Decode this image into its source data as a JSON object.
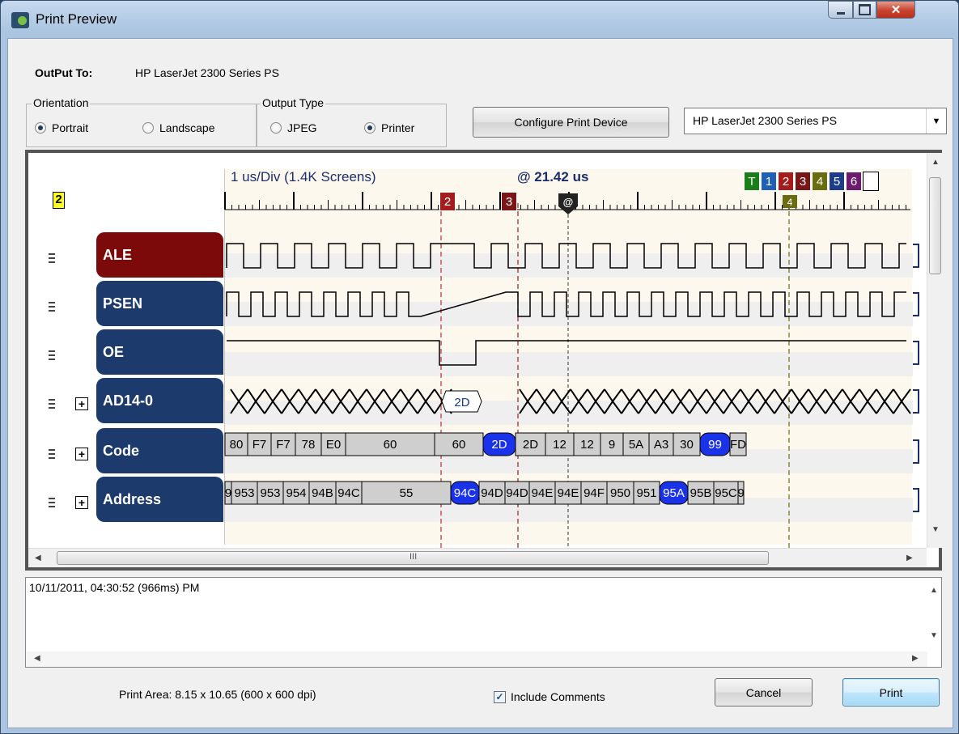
{
  "window": {
    "title": "Print Preview"
  },
  "output": {
    "label": "OutPut To:",
    "value": "HP LaserJet 2300 Series PS"
  },
  "orientation": {
    "title": "Orientation",
    "portrait": "Portrait",
    "landscape": "Landscape",
    "selected": "Portrait"
  },
  "output_type": {
    "title": "Output Type",
    "jpeg": "JPEG",
    "printer": "Printer",
    "selected": "Printer"
  },
  "configure_button": "Configure Print Device",
  "printer_select": {
    "value": "HP LaserJet 2300 Series PS"
  },
  "preview": {
    "group_marker": "2",
    "ruler_info": "1 us/Div  (1.4K Screens)",
    "ruler_at": "@ 21.42 us",
    "ruler_cursor": "@",
    "cursor_tags": [
      {
        "text": "T",
        "color": "#1a7f1a"
      },
      {
        "text": "1",
        "color": "#1e5fb8"
      },
      {
        "text": "2",
        "color": "#a51c1c"
      },
      {
        "text": "3",
        "color": "#7a1616"
      },
      {
        "text": "4",
        "color": "#6b6b10"
      },
      {
        "text": "5",
        "color": "#1c3c8c"
      },
      {
        "text": "6",
        "color": "#6e1a6e"
      }
    ],
    "cursor2_label": "2",
    "cursor3_label": "3",
    "cursor4_label": "4",
    "lanes": [
      {
        "name": "ALE",
        "color": "#7d0a0a"
      },
      {
        "name": "PSEN",
        "color": "#1c3a6b"
      },
      {
        "name": "OE",
        "color": "#1c3a6b"
      },
      {
        "name": "AD14-0",
        "color": "#1c3a6b",
        "bus_value": "2D"
      },
      {
        "name": "Code",
        "color": "#1c3a6b",
        "values": [
          "80",
          "F7",
          "F7",
          "78",
          "E0",
          "60",
          "60",
          "2D",
          "2D",
          "12",
          "12",
          "9",
          "5A",
          "A3",
          "30",
          "99",
          "FD"
        ]
      },
      {
        "name": "Address",
        "color": "#1c3a6b",
        "values": [
          "9",
          "953",
          "953",
          "954",
          "94B",
          "94C",
          "55",
          "94C",
          "94D",
          "94D",
          "94E",
          "94E",
          "94F",
          "950",
          "951",
          "95A",
          "95B",
          "95C",
          "9"
        ]
      }
    ],
    "scroll_mark": "III"
  },
  "comments": {
    "text": "10/11/2011, 04:30:52 (966ms) PM"
  },
  "footer": {
    "print_area": "Print Area: 8.15 x 10.65  (600 x 600 dpi)",
    "include_comments": "Include Comments",
    "include_checked": true,
    "cancel": "Cancel",
    "print": "Print"
  }
}
